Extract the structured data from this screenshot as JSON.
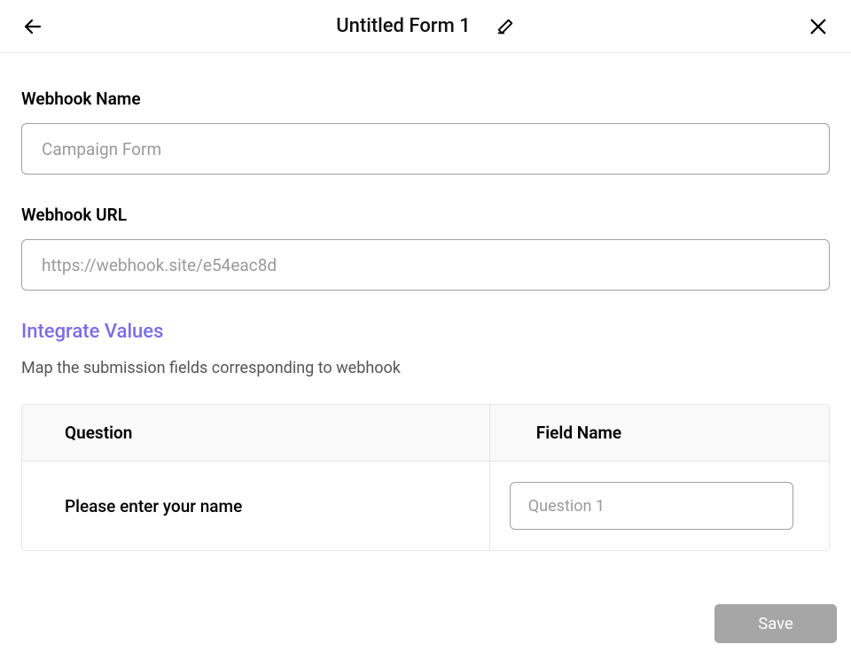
{
  "header": {
    "title": "Untitled Form  1"
  },
  "fields": {
    "webhook_name": {
      "label": "Webhook Name",
      "placeholder": "Campaign Form",
      "value": ""
    },
    "webhook_url": {
      "label": "Webhook URL",
      "placeholder": "https://webhook.site/e54eac8d",
      "value": ""
    }
  },
  "integrate": {
    "title": "Integrate Values",
    "desc": "Map the submission fields corresponding to webhook",
    "headers": {
      "question": "Question",
      "field_name": "Field Name"
    },
    "rows": [
      {
        "question": "Please enter your name",
        "field_placeholder": "Question 1",
        "field_value": ""
      }
    ]
  },
  "footer": {
    "save_label": "Save"
  }
}
